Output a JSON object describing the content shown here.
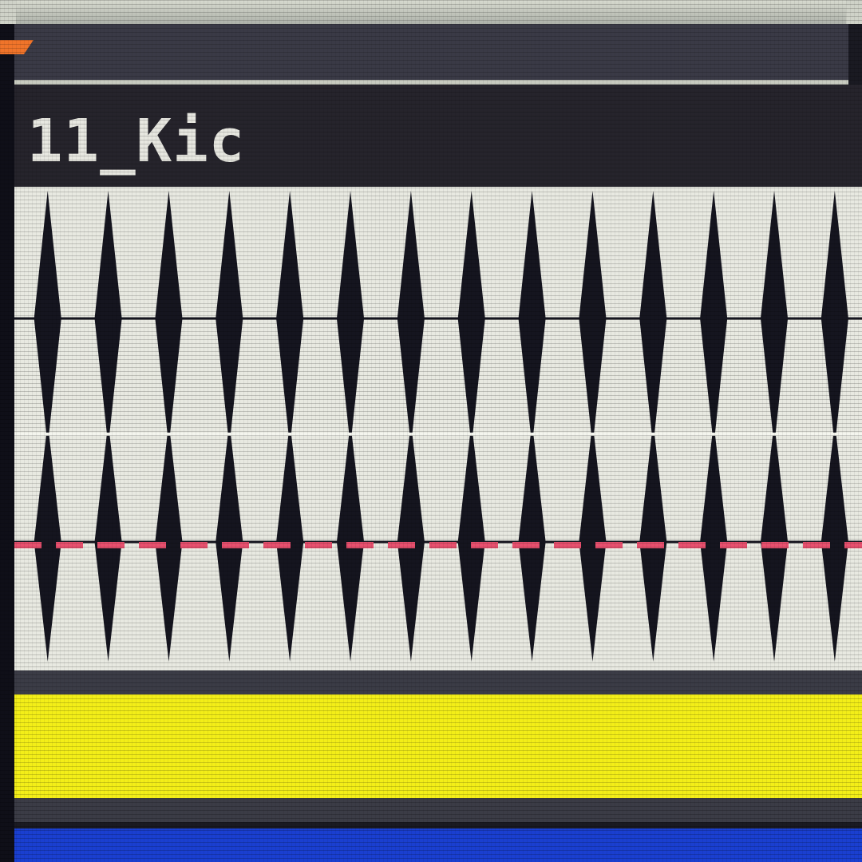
{
  "clip": {
    "title": "11_Kic",
    "icon": "orange-arrow-icon"
  },
  "colors": {
    "background": "#1a1a22",
    "clip_header": "#26242c",
    "waveform_bg": "#e8e9e1",
    "waveform": "#15151f",
    "playhead_marker": "#e8506e",
    "yellow_clip": "#f3ee18",
    "blue_lane": "#1a3fd0",
    "accent_orange": "#f0742a"
  },
  "waveform": {
    "channels": 2,
    "transients_per_channel": 14
  }
}
